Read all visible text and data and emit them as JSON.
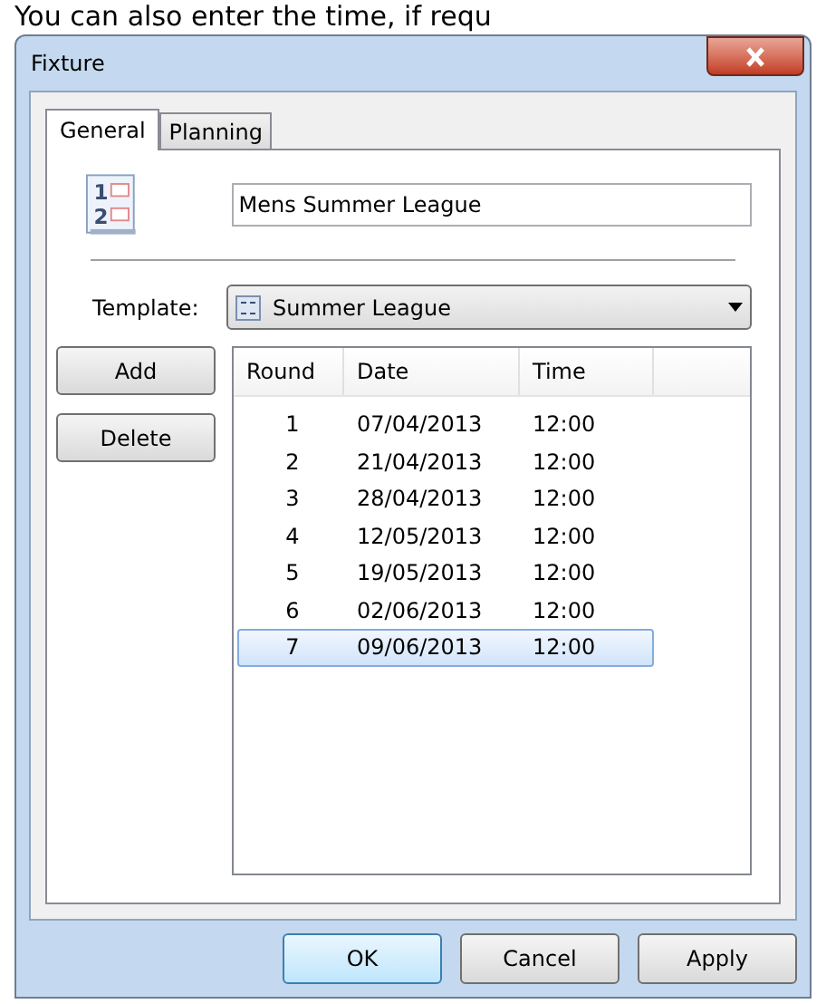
{
  "background_text": "You can also enter the time, if requ",
  "window": {
    "title": "Fixture"
  },
  "icon_digits": [
    "1",
    "2"
  ],
  "tabs": [
    {
      "label": "General",
      "selected": true
    },
    {
      "label": "Planning",
      "selected": false
    }
  ],
  "name_field": {
    "value": "Mens Summer League"
  },
  "template": {
    "label": "Template:",
    "value": "Summer League"
  },
  "side_buttons": [
    "Add",
    "Delete"
  ],
  "table": {
    "columns": [
      "Round",
      "Date",
      "Time"
    ],
    "rows": [
      {
        "round": "1",
        "date": "07/04/2013",
        "time": "12:00",
        "selected": false
      },
      {
        "round": "2",
        "date": "21/04/2013",
        "time": "12:00",
        "selected": false
      },
      {
        "round": "3",
        "date": "28/04/2013",
        "time": "12:00",
        "selected": false
      },
      {
        "round": "4",
        "date": "12/05/2013",
        "time": "12:00",
        "selected": false
      },
      {
        "round": "5",
        "date": "19/05/2013",
        "time": "12:00",
        "selected": false
      },
      {
        "round": "6",
        "date": "02/06/2013",
        "time": "12:00",
        "selected": false
      },
      {
        "round": "7",
        "date": "09/06/2013",
        "time": "12:00",
        "selected": true
      }
    ]
  },
  "footer_buttons": [
    {
      "label": "OK",
      "default": true
    },
    {
      "label": "Cancel",
      "default": false
    },
    {
      "label": "Apply",
      "default": false
    }
  ]
}
